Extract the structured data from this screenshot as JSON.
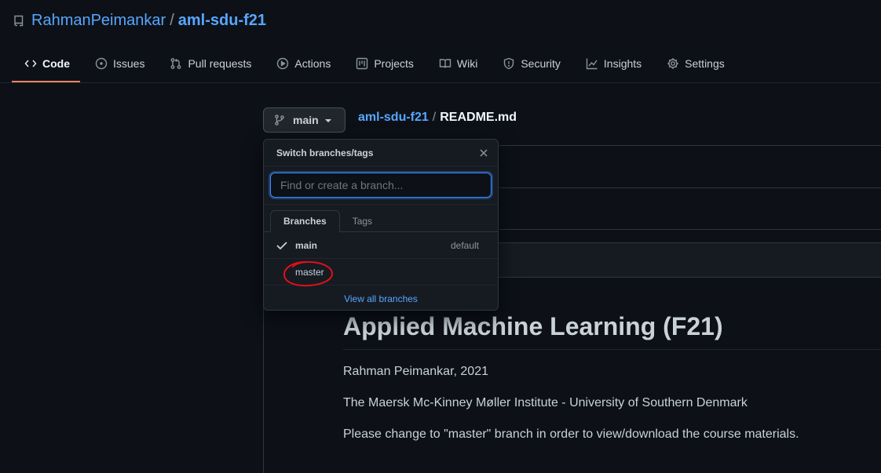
{
  "header": {
    "owner": "RahmanPeimankar",
    "separator": "/",
    "repo": "aml-sdu-f21"
  },
  "nav": {
    "tabs": [
      {
        "label": "Code",
        "icon": "code-icon",
        "active": true
      },
      {
        "label": "Issues",
        "icon": "issue-icon"
      },
      {
        "label": "Pull requests",
        "icon": "pull-request-icon"
      },
      {
        "label": "Actions",
        "icon": "play-icon"
      },
      {
        "label": "Projects",
        "icon": "project-icon"
      },
      {
        "label": "Wiki",
        "icon": "book-icon"
      },
      {
        "label": "Security",
        "icon": "shield-icon"
      },
      {
        "label": "Insights",
        "icon": "graph-icon"
      },
      {
        "label": "Settings",
        "icon": "gear-icon"
      }
    ]
  },
  "branch_button": {
    "label": "main"
  },
  "breadcrumb": {
    "repo": "aml-sdu-f21",
    "separator": "/",
    "file": "README.md"
  },
  "dropdown": {
    "title": "Switch branches/tags",
    "filter_placeholder": "Find or create a branch...",
    "tabs": [
      "Branches",
      "Tags"
    ],
    "branches": [
      {
        "name": "main",
        "selected": true,
        "badge": "default"
      },
      {
        "name": "master",
        "selected": false,
        "badge": ""
      }
    ],
    "footer_link": "View all branches"
  },
  "readme": {
    "title": "Applied Machine Learning (F21)",
    "paragraphs": [
      "Rahman Peimankar, 2021",
      "The Maersk Mc-Kinney Møller Institute - University of Southern Denmark",
      "Please change to \"master\" branch in order to view/download the course materials."
    ]
  },
  "colors": {
    "background": "#0d1117",
    "link": "#58a6ff",
    "tab_underline": "#f78166",
    "annotation": "#e0101a"
  }
}
